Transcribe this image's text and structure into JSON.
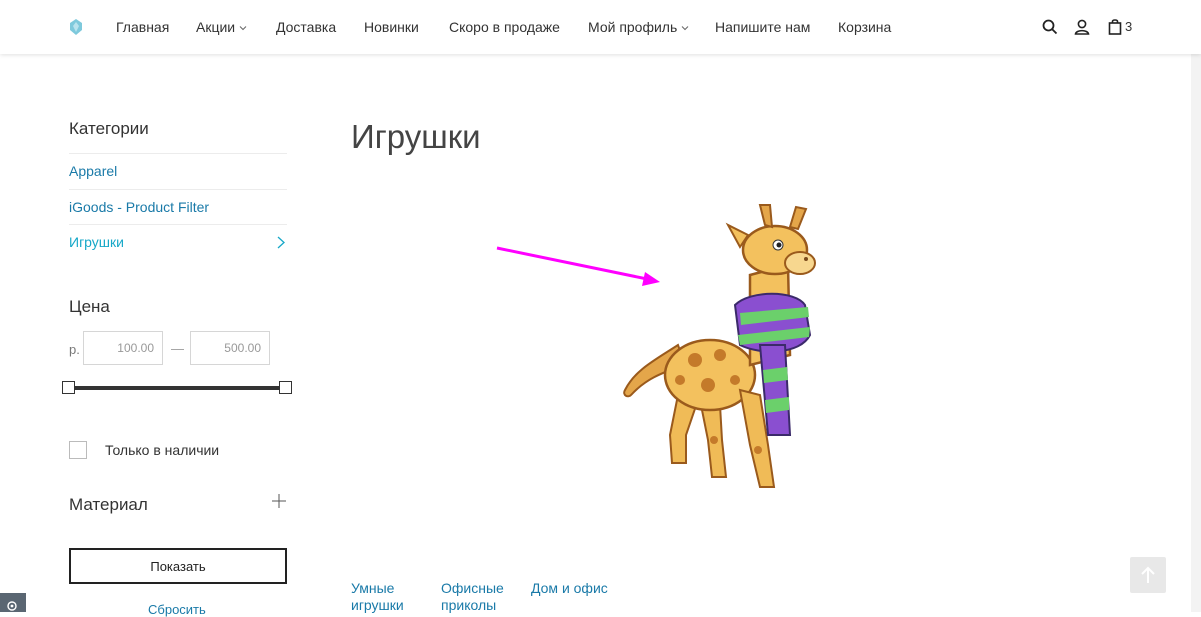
{
  "header": {
    "nav": [
      {
        "label": "Главная"
      },
      {
        "label": "Акции"
      },
      {
        "label": "Доставка"
      },
      {
        "label": "Новинки"
      },
      {
        "label": "Скоро в продаже"
      },
      {
        "label": "Мой профиль"
      },
      {
        "label": "Напишите нам"
      },
      {
        "label": "Корзина"
      }
    ],
    "cart_count": "3"
  },
  "sidebar": {
    "categories_title": "Категории",
    "categories": [
      {
        "label": "Apparel"
      },
      {
        "label": "iGoods - Product Filter"
      },
      {
        "label": "Игрушки"
      }
    ],
    "price_title": "Цена",
    "currency": "р.",
    "price_min": "100.00",
    "price_max": "500.00",
    "price_separator": "—",
    "in_stock_label": "Только в наличии",
    "material_title": "Материал",
    "show_label": "Показать",
    "reset_label": "Сбросить"
  },
  "main": {
    "title": "Игрушки",
    "subcategories": [
      {
        "line1": "Умные",
        "line2": "игрушки"
      },
      {
        "line1": "Офисные",
        "line2": "приколы"
      },
      {
        "line1": "Дом и офис",
        "line2": ""
      }
    ]
  },
  "colors": {
    "link": "#1a7aa8",
    "active": "#17a8c8",
    "annotation_arrow": "#ff00ff"
  }
}
